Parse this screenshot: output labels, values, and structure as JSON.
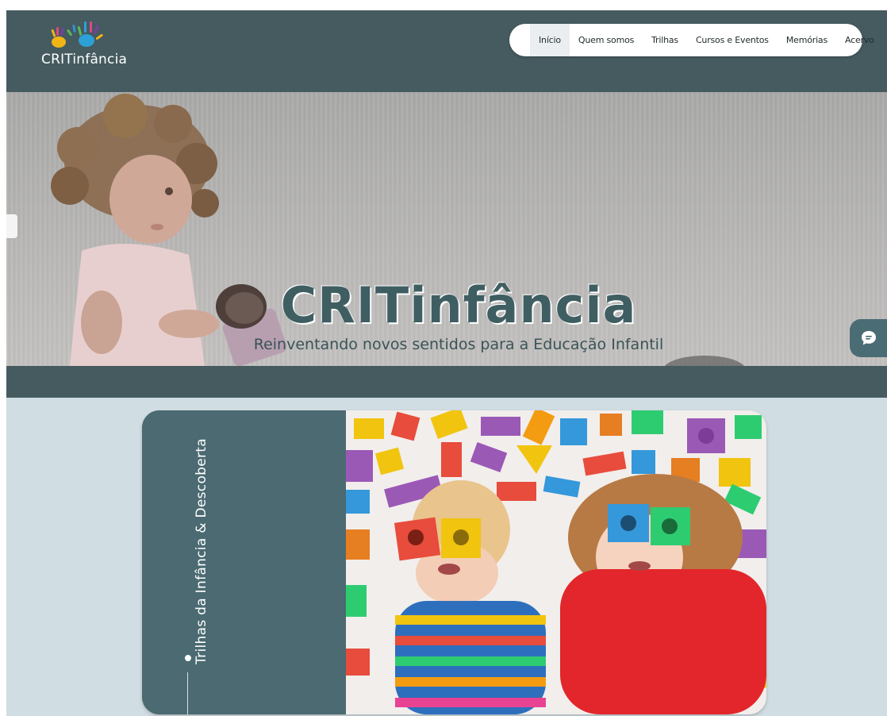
{
  "brand": {
    "logo_text": "CRITinfância",
    "hand_colors": [
      "#7b3fa0",
      "#e0468c",
      "#2da0d8",
      "#f1b515",
      "#5cb85c",
      "#3a8fd0"
    ]
  },
  "nav": {
    "items": [
      {
        "label": "Início",
        "active": true
      },
      {
        "label": "Quem somos",
        "active": false
      },
      {
        "label": "Trilhas",
        "active": false
      },
      {
        "label": "Cursos e Eventos",
        "active": false
      },
      {
        "label": "Memórias",
        "active": false
      },
      {
        "label": "Acervo",
        "active": false
      }
    ]
  },
  "hero": {
    "title": "CRITinfância",
    "subtitle": "Reinventando novos sentidos para a Educação Infantil"
  },
  "trails": {
    "title": "Trilhas da Infância & Descoberta"
  },
  "colors": {
    "header_bg": "#455b60",
    "card_bg": "#4b6a72",
    "section_bg": "#d0dde2",
    "title_teal": "#3f5e62"
  },
  "icons": {
    "chat": "chat-bubble-icon"
  }
}
